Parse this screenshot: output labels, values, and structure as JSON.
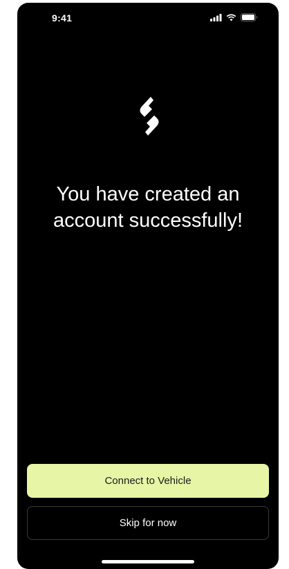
{
  "status_bar": {
    "time": "9:41",
    "icons": [
      "cellular-signal-icon",
      "wifi-icon",
      "battery-icon"
    ]
  },
  "logo": {
    "icon": "brand-logo-icon"
  },
  "headline": {
    "line1": "You have created an",
    "line2": "account successfully!"
  },
  "actions": {
    "primary_label": "Connect to Vehicle",
    "secondary_label": "Skip for now"
  },
  "colors": {
    "background": "#000000",
    "accent": "#e6f5a6",
    "text": "#ffffff"
  }
}
